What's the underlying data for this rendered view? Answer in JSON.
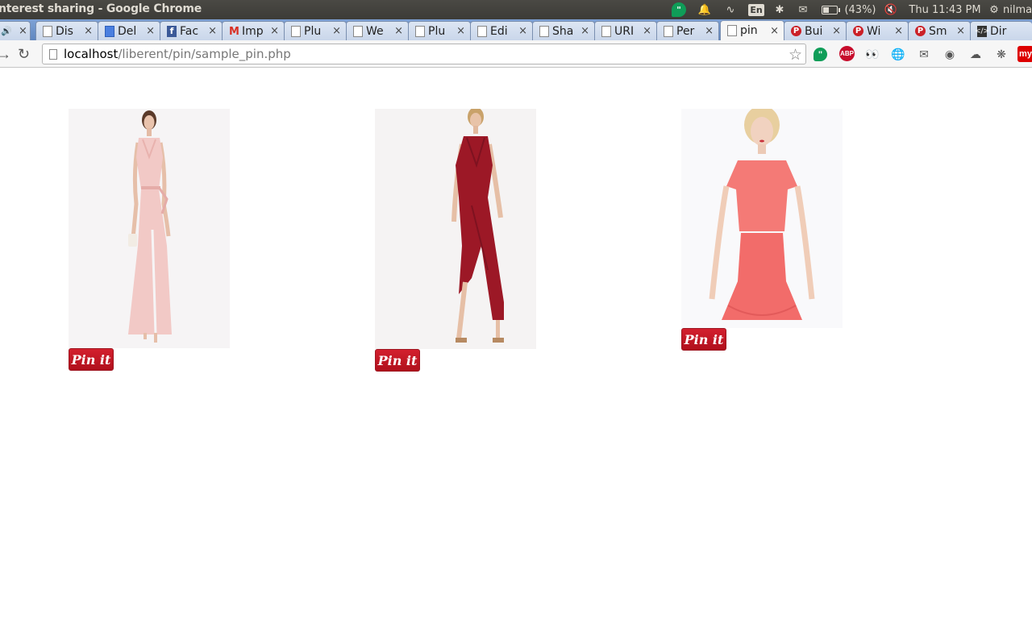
{
  "os_panel": {
    "window_title": "nterest sharing - Google Chrome",
    "battery": "(43%)",
    "clock": "Thu 11:43 PM",
    "user": "nilma",
    "lang": "En"
  },
  "tabs": [
    {
      "label": "",
      "icon": "audio-icon"
    },
    {
      "label": "Dis",
      "icon": "page-icon"
    },
    {
      "label": "Del",
      "icon": "docs-icon"
    },
    {
      "label": "Fac",
      "icon": "facebook-icon"
    },
    {
      "label": "Imp",
      "icon": "gmail-icon"
    },
    {
      "label": "Plu",
      "icon": "page-icon"
    },
    {
      "label": "We",
      "icon": "page-icon"
    },
    {
      "label": "Plu",
      "icon": "page-icon"
    },
    {
      "label": "Edi",
      "icon": "page-icon"
    },
    {
      "label": "Sha",
      "icon": "page-icon"
    },
    {
      "label": "URI",
      "icon": "page-icon"
    },
    {
      "label": "Per",
      "icon": "page-icon"
    },
    {
      "label": "pin",
      "icon": "page-icon",
      "active": true
    },
    {
      "label": "Bui",
      "icon": "pinterest-icon"
    },
    {
      "label": "Wi",
      "icon": "pinterest-icon"
    },
    {
      "label": "Sm",
      "icon": "pinterest-icon"
    },
    {
      "label": "Dir",
      "icon": "code-icon"
    }
  ],
  "address_bar": {
    "host": "localhost",
    "path": "/liberent/pin/sample_pin.php"
  },
  "pins": [
    {
      "button_label": "Pin it",
      "dress": "blush-pink-wrap-maxi-dress"
    },
    {
      "button_label": "Pin it",
      "dress": "burgundy-wrap-maxi-dress"
    },
    {
      "button_label": "Pin it",
      "dress": "coral-crop-top-peplum-dress"
    }
  ],
  "colors": {
    "pin_red": "#cb2027",
    "tab_strip": "#6d93c8",
    "panel": "#3c3b37"
  }
}
